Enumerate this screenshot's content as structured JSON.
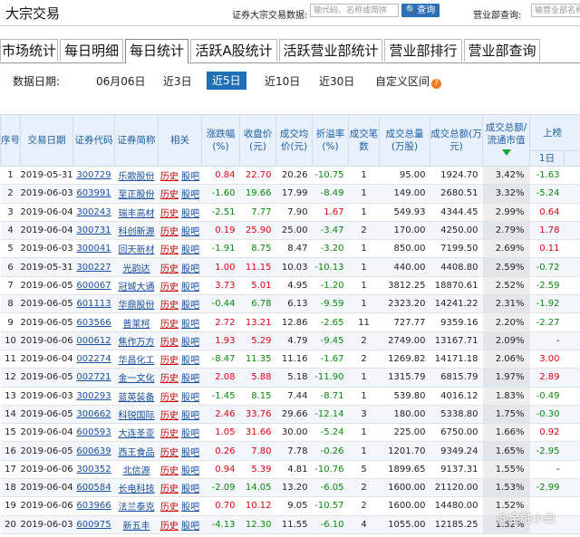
{
  "header": {
    "logo": "大宗交易",
    "query1_label": "证券大宗交易数据:",
    "query1_placeholder": "输代码、名称或简拼",
    "query1_button": "查询",
    "query2_label": "营业部查询:",
    "query2_placeholder": "输营业部名称"
  },
  "tabs": [
    "市场统计",
    "每日明细",
    "每日统计",
    "活跃A股统计",
    "活跃营业部统计",
    "营业部排行",
    "营业部查询"
  ],
  "active_tab": "每日统计",
  "date_filter": {
    "label": "数据日期:",
    "options": [
      "06月06日",
      "近3日",
      "近5日",
      "近10日",
      "近30日",
      "自定义区间"
    ],
    "active": "近5日"
  },
  "table": {
    "headers": [
      "序号",
      "交易日期",
      "证券代码",
      "证券简称",
      "相关",
      "涨跌幅(%)",
      "收盘价(元)",
      "成交均价(元)",
      "折溢率(%)",
      "成交笔数",
      "成交总量(万股)",
      "成交总额(万元)",
      "成交总额/流通市值",
      "上榜"
    ],
    "sub_header": "1日",
    "rows": [
      {
        "no": "1",
        "date": "2019-05-31",
        "code": "300729",
        "name": "乐歌股份",
        "chg": "0.84",
        "close": "22.70",
        "avg": "20.26",
        "prem": "-10.75",
        "cnt": "1",
        "vol": "95.00",
        "amt": "1924.70",
        "ratio": "3.42%",
        "d1": "-1.63"
      },
      {
        "no": "2",
        "date": "2019-06-03",
        "code": "603991",
        "name": "至正股份",
        "chg": "-1.60",
        "close": "19.66",
        "avg": "17.99",
        "prem": "-8.49",
        "cnt": "1",
        "vol": "149.00",
        "amt": "2680.51",
        "ratio": "3.32%",
        "d1": "-5.24"
      },
      {
        "no": "3",
        "date": "2019-06-04",
        "code": "300243",
        "name": "瑞丰高材",
        "chg": "-2.51",
        "close": "7.77",
        "avg": "7.90",
        "prem": "1.67",
        "cnt": "1",
        "vol": "549.93",
        "amt": "4344.45",
        "ratio": "2.99%",
        "d1": "0.64"
      },
      {
        "no": "4",
        "date": "2019-06-04",
        "code": "300731",
        "name": "科创新源",
        "chg": "0.19",
        "close": "25.90",
        "avg": "25.00",
        "prem": "-3.47",
        "cnt": "2",
        "vol": "170.00",
        "amt": "4250.00",
        "ratio": "2.79%",
        "d1": "1.78"
      },
      {
        "no": "5",
        "date": "2019-06-03",
        "code": "300041",
        "name": "回天新材",
        "chg": "-1.91",
        "close": "8.75",
        "avg": "8.47",
        "prem": "-3.20",
        "cnt": "1",
        "vol": "850.00",
        "amt": "7199.50",
        "ratio": "2.69%",
        "d1": "0.11"
      },
      {
        "no": "6",
        "date": "2019-05-31",
        "code": "300227",
        "name": "光韵达",
        "chg": "1.00",
        "close": "11.15",
        "avg": "10.03",
        "prem": "-10.13",
        "cnt": "1",
        "vol": "440.00",
        "amt": "4408.80",
        "ratio": "2.59%",
        "d1": "-0.72"
      },
      {
        "no": "7",
        "date": "2019-06-05",
        "code": "600067",
        "name": "冠城大通",
        "chg": "3.73",
        "close": "5.01",
        "avg": "4.95",
        "prem": "-1.20",
        "cnt": "1",
        "vol": "3812.25",
        "amt": "18870.61",
        "ratio": "2.52%",
        "d1": "-2.59"
      },
      {
        "no": "8",
        "date": "2019-06-05",
        "code": "601113",
        "name": "华鼎股份",
        "chg": "-0.44",
        "close": "6.78",
        "avg": "6.13",
        "prem": "-9.59",
        "cnt": "1",
        "vol": "2323.20",
        "amt": "14241.22",
        "ratio": "2.31%",
        "d1": "-1.92"
      },
      {
        "no": "9",
        "date": "2019-06-05",
        "code": "603566",
        "name": "普莱柯",
        "chg": "2.72",
        "close": "13.21",
        "avg": "12.86",
        "prem": "-2.65",
        "cnt": "11",
        "vol": "727.77",
        "amt": "9359.16",
        "ratio": "2.20%",
        "d1": "-2.27"
      },
      {
        "no": "10",
        "date": "2019-06-06",
        "code": "000612",
        "name": "焦作万方",
        "chg": "1.93",
        "close": "5.29",
        "avg": "4.79",
        "prem": "-9.45",
        "cnt": "2",
        "vol": "2749.00",
        "amt": "13167.71",
        "ratio": "2.09%",
        "d1": "-"
      },
      {
        "no": "11",
        "date": "2019-06-04",
        "code": "002274",
        "name": "华昌化工",
        "chg": "-8.47",
        "close": "11.35",
        "avg": "11.16",
        "prem": "-1.67",
        "cnt": "2",
        "vol": "1269.82",
        "amt": "14171.18",
        "ratio": "2.06%",
        "d1": "3.00"
      },
      {
        "no": "12",
        "date": "2019-06-05",
        "code": "002721",
        "name": "金一文化",
        "chg": "2.08",
        "close": "5.88",
        "avg": "5.18",
        "prem": "-11.90",
        "cnt": "1",
        "vol": "1315.79",
        "amt": "6815.79",
        "ratio": "1.97%",
        "d1": "2.89"
      },
      {
        "no": "13",
        "date": "2019-06-03",
        "code": "300293",
        "name": "蓝英装备",
        "chg": "-1.45",
        "close": "8.15",
        "avg": "7.44",
        "prem": "-8.71",
        "cnt": "1",
        "vol": "539.80",
        "amt": "4016.12",
        "ratio": "1.83%",
        "d1": "-0.49"
      },
      {
        "no": "14",
        "date": "2019-06-05",
        "code": "300662",
        "name": "科锐国际",
        "chg": "2.46",
        "close": "33.76",
        "avg": "29.66",
        "prem": "-12.14",
        "cnt": "3",
        "vol": "180.00",
        "amt": "5338.80",
        "ratio": "1.75%",
        "d1": "-0.30"
      },
      {
        "no": "15",
        "date": "2019-06-04",
        "code": "600593",
        "name": "大连圣亚",
        "chg": "1.05",
        "close": "31.66",
        "avg": "30.00",
        "prem": "-5.24",
        "cnt": "1",
        "vol": "225.00",
        "amt": "6750.00",
        "ratio": "1.66%",
        "d1": "0.92"
      },
      {
        "no": "16",
        "date": "2019-06-05",
        "code": "600639",
        "name": "西王食品",
        "chg": "0.26",
        "close": "7.80",
        "avg": "7.78",
        "prem": "-0.26",
        "cnt": "1",
        "vol": "1201.70",
        "amt": "9349.24",
        "ratio": "1.65%",
        "d1": "-2.95"
      },
      {
        "no": "17",
        "date": "2019-06-06",
        "code": "300352",
        "name": "北信源",
        "chg": "0.94",
        "close": "5.39",
        "avg": "4.81",
        "prem": "-10.76",
        "cnt": "5",
        "vol": "1899.65",
        "amt": "9137.31",
        "ratio": "1.55%",
        "d1": "-"
      },
      {
        "no": "18",
        "date": "2019-06-04",
        "code": "600584",
        "name": "长电科技",
        "chg": "-2.09",
        "close": "14.05",
        "avg": "13.20",
        "prem": "-6.05",
        "cnt": "2",
        "vol": "1600.00",
        "amt": "21120.00",
        "ratio": "1.53%",
        "d1": "-2.99"
      },
      {
        "no": "19",
        "date": "2019-06-06",
        "code": "603966",
        "name": "法兰泰克",
        "chg": "0.70",
        "close": "10.12",
        "avg": "9.05",
        "prem": "-10.57",
        "cnt": "2",
        "vol": "1600.00",
        "amt": "14480.00",
        "ratio": "1.52%",
        "d1": ""
      },
      {
        "no": "20",
        "date": "2019-06-03",
        "code": "600975",
        "name": "新五丰",
        "chg": "-4.13",
        "close": "12.30",
        "avg": "11.55",
        "prem": "-6.10",
        "cnt": "4",
        "vol": "1055.00",
        "amt": "12185.25",
        "ratio": "1.52%",
        "d1": ""
      }
    ],
    "link_history": "历史",
    "link_forum": "股吧"
  },
  "watermark": "@金融小白"
}
